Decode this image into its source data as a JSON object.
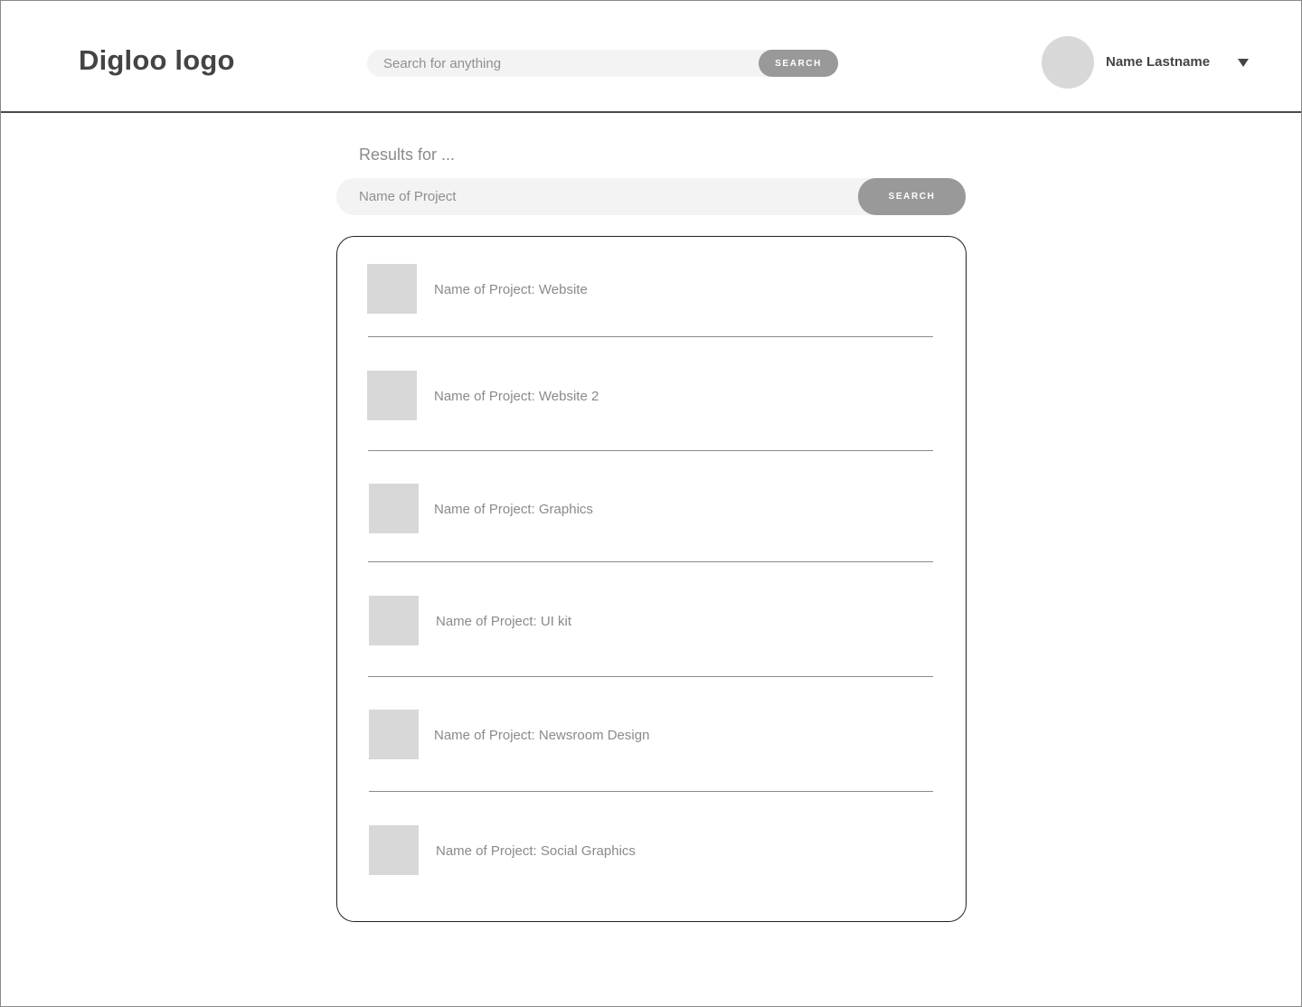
{
  "header": {
    "logo": "Digloo logo",
    "search_placeholder": "Search for anything",
    "search_button": "SEARCH",
    "user_name": "Name Lastname"
  },
  "results": {
    "heading": "Results for ...",
    "search_placeholder": "Name of Project",
    "search_button": "SEARCH",
    "items": [
      {
        "label": "Name of Project: Website"
      },
      {
        "label": "Name of Project: Website 2"
      },
      {
        "label": "Name of Project: Graphics"
      },
      {
        "label": "Name of Project: UI kit"
      },
      {
        "label": "Name of Project: Newsroom Design"
      },
      {
        "label": "Name of Project: Social Graphics"
      }
    ]
  },
  "colors": {
    "thumbnail": "#d8d8d8",
    "button": "#999999",
    "input_bg": "#f3f3f3",
    "text_muted": "#8a8a8a",
    "text_dark": "#444444"
  }
}
